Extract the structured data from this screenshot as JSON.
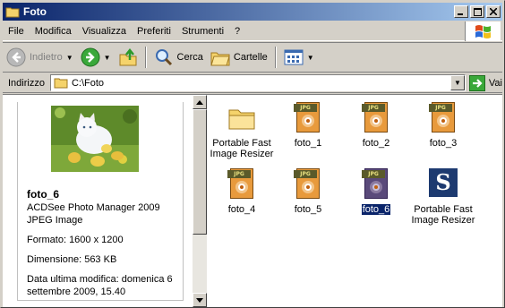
{
  "window": {
    "title": "Foto",
    "controls": [
      "minimize",
      "maximize",
      "close"
    ]
  },
  "menu": [
    {
      "label": "File",
      "underline": "F"
    },
    {
      "label": "Modifica",
      "underline": "M"
    },
    {
      "label": "Visualizza",
      "underline": "V"
    },
    {
      "label": "Preferiti",
      "underline": "P"
    },
    {
      "label": "Strumenti",
      "underline": "S"
    },
    {
      "label": "?",
      "underline": "?"
    }
  ],
  "toolbar": {
    "back_label": "Indietro",
    "search_label": "Cerca",
    "folders_label": "Cartelle"
  },
  "address": {
    "label": "Indirizzo",
    "value": "C:\\Foto",
    "go_label": "Vai"
  },
  "preview": {
    "name": "foto_6",
    "type_line1": "ACDSee Photo Manager 2009",
    "type_line2": "JPEG Image",
    "format": "Formato: 1600 x 1200",
    "size": "Dimensione: 563 KB",
    "modified": "Data ultima modifica: domenica 6 settembre 2009, 15.40"
  },
  "files": [
    {
      "name": "Portable Fast Image Resizer",
      "kind": "folder"
    },
    {
      "name": "foto_1",
      "kind": "jpg"
    },
    {
      "name": "foto_2",
      "kind": "jpg"
    },
    {
      "name": "foto_3",
      "kind": "jpg"
    },
    {
      "name": "foto_4",
      "kind": "jpg"
    },
    {
      "name": "foto_5",
      "kind": "jpg"
    },
    {
      "name": "foto_6",
      "kind": "jpg",
      "selected": true
    },
    {
      "name": "Portable Fast Image Resizer",
      "kind": "app"
    }
  ],
  "icons": {
    "jpg_tag": "JPG",
    "app_letter": "S"
  },
  "colors": {
    "titlebar": "#0a246a",
    "selection": "#0a246a",
    "chrome": "#d4d0c8"
  }
}
